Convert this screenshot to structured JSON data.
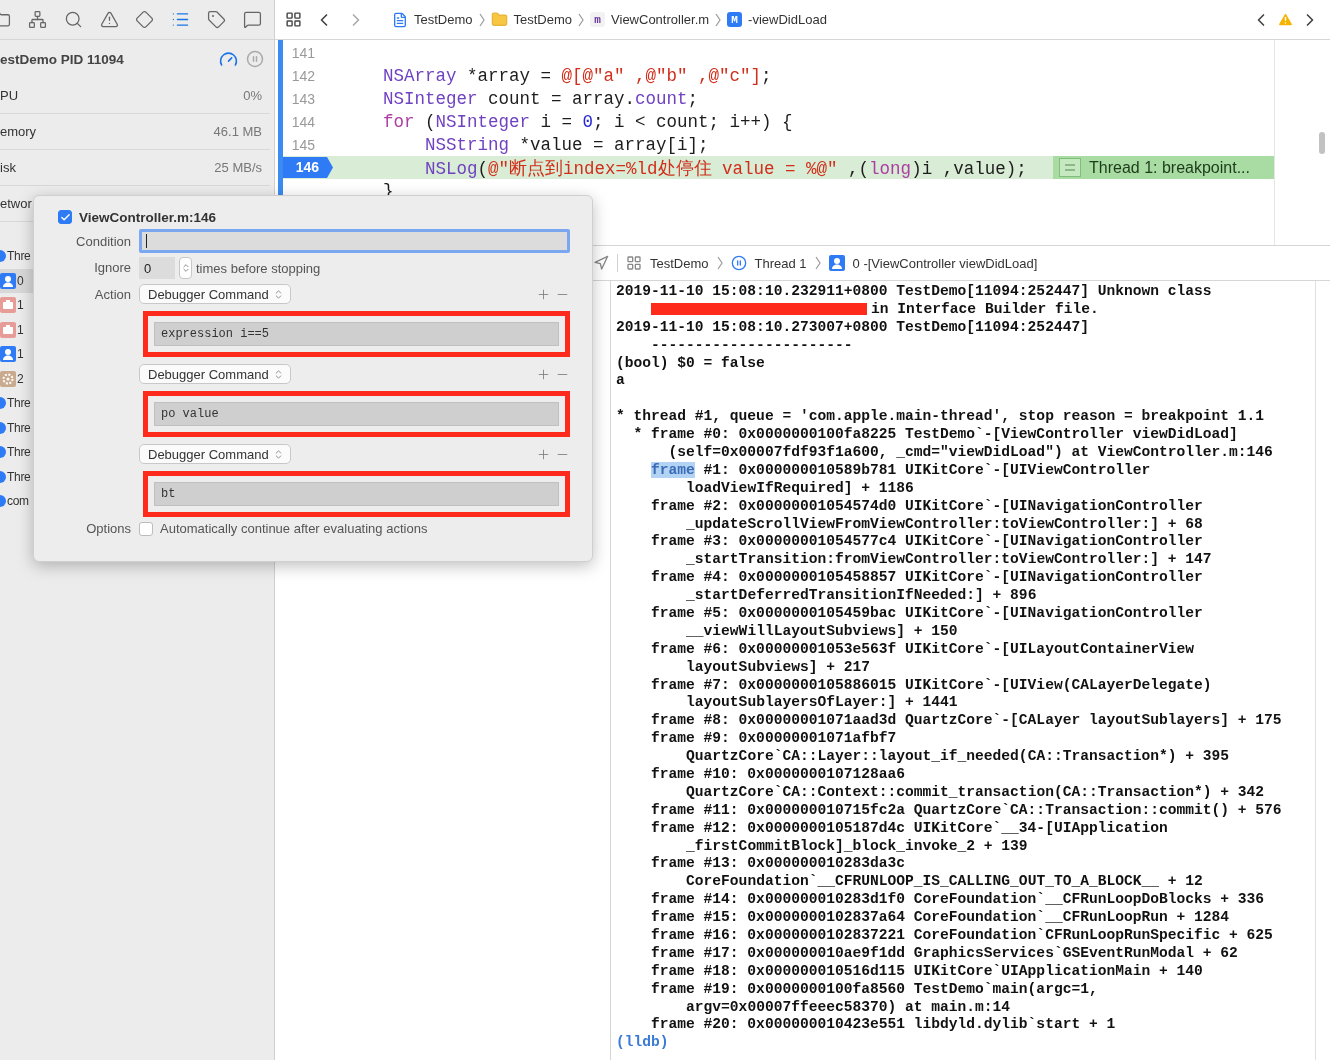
{
  "navigator": {
    "header": {
      "title": "estDemo PID 11094"
    },
    "gauges": [
      {
        "label": "PU",
        "value": "0%"
      },
      {
        "label": "emory",
        "value": "46.1 MB"
      },
      {
        "label": "isk",
        "value": "25 MB/s"
      },
      {
        "label": "etwor"
      }
    ],
    "threads": [
      {
        "kind": "thread",
        "label": "Thre",
        "selected": false
      },
      {
        "kind": "person",
        "label": "0",
        "selected": true
      },
      {
        "kind": "case",
        "label": "1",
        "selected": false
      },
      {
        "kind": "case",
        "label": "1",
        "selected": false
      },
      {
        "kind": "person",
        "label": "1",
        "selected": false
      },
      {
        "kind": "gear",
        "label": "2",
        "selected": false
      },
      {
        "kind": "thread",
        "label": "Thre",
        "selected": false
      },
      {
        "kind": "thread",
        "label": "Thre",
        "selected": false
      },
      {
        "kind": "thread",
        "label": "Thre",
        "selected": false
      },
      {
        "kind": "thread",
        "label": "Thre",
        "selected": false
      },
      {
        "kind": "thread",
        "label": "com",
        "selected": false
      }
    ]
  },
  "navigator_tabs": [
    {
      "kind": "folder",
      "selected": false
    },
    {
      "kind": "hierarchy",
      "selected": false
    },
    {
      "kind": "search",
      "selected": false
    },
    {
      "kind": "warning",
      "selected": false
    },
    {
      "kind": "diamond",
      "selected": false
    },
    {
      "kind": "list",
      "selected": true
    },
    {
      "kind": "tag",
      "selected": false
    },
    {
      "kind": "comment",
      "selected": false
    }
  ],
  "jump_bar": [
    {
      "kind": "project",
      "label": "TestDemo"
    },
    {
      "kind": "folder",
      "label": "TestDemo"
    },
    {
      "kind": "m-file",
      "badge": "m",
      "label": "ViewController.m"
    },
    {
      "kind": "method",
      "badge": "M",
      "label": "-viewDidLoad"
    }
  ],
  "editor": {
    "lines": [
      {
        "number": "141"
      },
      {
        "number": "142",
        "tokens": [
          {
            "t": "    NSArray",
            "kind": "type"
          },
          {
            "t": " *array = ",
            "kind": "plain"
          },
          {
            "t": "@[@\"a\" ,@\"b\" ,@\"c\"]",
            "kind": "string"
          },
          {
            "t": ";",
            "kind": "plain"
          }
        ]
      },
      {
        "number": "143",
        "tokens": [
          {
            "t": "    NSInteger",
            "kind": "type"
          },
          {
            "t": " count = array.",
            "kind": "plain"
          },
          {
            "t": "count",
            "kind": "type"
          },
          {
            "t": ";",
            "kind": "plain"
          }
        ]
      },
      {
        "number": "144",
        "tokens": [
          {
            "t": "    for",
            "kind": "keyword"
          },
          {
            "t": " (",
            "kind": "plain"
          },
          {
            "t": "NSInteger",
            "kind": "type"
          },
          {
            "t": " i = ",
            "kind": "plain"
          },
          {
            "t": "0",
            "kind": "number"
          },
          {
            "t": "; i < count; i++) {",
            "kind": "plain"
          }
        ]
      },
      {
        "number": "145",
        "tokens": [
          {
            "t": "        NSString",
            "kind": "type"
          },
          {
            "t": " *value = array[i];",
            "kind": "plain"
          }
        ]
      },
      {
        "number": "146",
        "current": true,
        "tokens": [
          {
            "t": "        NSLog",
            "kind": "type"
          },
          {
            "t": "(",
            "kind": "plain"
          },
          {
            "t": "@\"断点到index=%ld处停住 value = %@\"",
            "kind": "string"
          },
          {
            "t": " ,(",
            "kind": "plain"
          },
          {
            "t": "long",
            "kind": "keyword"
          },
          {
            "t": ")i ,value);",
            "kind": "plain"
          }
        ],
        "annotation": "Thread 1: breakpoint..."
      },
      {
        "tokens": [
          {
            "t": "    }",
            "kind": "plain"
          }
        ]
      }
    ]
  },
  "debug_bar": [
    {
      "kind": "app",
      "label": "TestDemo"
    },
    {
      "kind": "thread",
      "label": "Thread 1"
    },
    {
      "kind": "person",
      "label": "0 -[ViewController viewDidLoad]"
    }
  ],
  "console": [
    {
      "kind": "plain",
      "text": "2019-11-10 15:08:10.232911+0800 TestDemo[11094:252447] Unknown class"
    },
    {
      "kind": "redacted",
      "text": "in Interface Builder file."
    },
    {
      "kind": "plain",
      "text": "2019-11-10 15:08:10.273007+0800 TestDemo[11094:252447]"
    },
    {
      "kind": "frame",
      "text": "-----------------------"
    },
    {
      "kind": "plain",
      "text": "(bool) $0 = false"
    },
    {
      "kind": "plain",
      "text": "a"
    },
    {
      "kind": "blank"
    },
    {
      "kind": "plain",
      "text": "* thread #1, queue = 'com.apple.main-thread', stop reason = breakpoint 1.1"
    },
    {
      "kind": "top",
      "text": "* frame #0: 0x0000000100fa8225 TestDemo`-[ViewController viewDidLoad]"
    },
    {
      "kind": "sub",
      "text": "(self=0x00007fdf93f1a600, _cmd=\"viewDidLoad\") at ViewController.m:146"
    },
    {
      "kind": "frame",
      "selection": "frame",
      "text": "#1: 0x000000010589b781 UIKitCore`-[UIViewController"
    },
    {
      "kind": "cont",
      "text": "loadViewIfRequired] + 1186"
    },
    {
      "kind": "frame",
      "text": "frame #2: 0x00000001054574d0 UIKitCore`-[UINavigationController"
    },
    {
      "kind": "cont",
      "text": "_updateScrollViewFromViewController:toViewController:] + 68"
    },
    {
      "kind": "frame",
      "text": "frame #3: 0x00000001054577c4 UIKitCore`-[UINavigationController"
    },
    {
      "kind": "cont",
      "text": "_startTransition:fromViewController:toViewController:] + 147"
    },
    {
      "kind": "frame",
      "text": "frame #4: 0x0000000105458857 UIKitCore`-[UINavigationController"
    },
    {
      "kind": "cont",
      "text": "_startDeferredTransitionIfNeeded:] + 896"
    },
    {
      "kind": "frame",
      "text": "frame #5: 0x0000000105459bac UIKitCore`-[UINavigationController"
    },
    {
      "kind": "cont",
      "text": "__viewWillLayoutSubviews] + 150"
    },
    {
      "kind": "frame",
      "text": "frame #6: 0x00000001053e563f UIKitCore`-[UILayoutContainerView"
    },
    {
      "kind": "cont",
      "text": "layoutSubviews] + 217"
    },
    {
      "kind": "frame",
      "text": "frame #7: 0x0000000105886015 UIKitCore`-[UIView(CALayerDelegate)"
    },
    {
      "kind": "cont",
      "text": "layoutSublayersOfLayer:] + 1441"
    },
    {
      "kind": "frame",
      "text": "frame #8: 0x00000001071aad3d QuartzCore`-[CALayer layoutSublayers] + 175"
    },
    {
      "kind": "frame",
      "text": "frame #9: 0x00000001071afbf7"
    },
    {
      "kind": "cont",
      "text": "QuartzCore`CA::Layer::layout_if_needed(CA::Transaction*) + 395"
    },
    {
      "kind": "frame",
      "text": "frame #10: 0x0000000107128aa6"
    },
    {
      "kind": "cont",
      "text": "QuartzCore`CA::Context::commit_transaction(CA::Transaction*) + 342"
    },
    {
      "kind": "frame",
      "text": "frame #11: 0x000000010715fc2a QuartzCore`CA::Transaction::commit() + 576"
    },
    {
      "kind": "frame",
      "text": "frame #12: 0x0000000105187d4c UIKitCore`__34-[UIApplication"
    },
    {
      "kind": "cont",
      "text": "_firstCommitBlock]_block_invoke_2 + 139"
    },
    {
      "kind": "frame",
      "text": "frame #13: 0x000000010283da3c"
    },
    {
      "kind": "cont",
      "text": "CoreFoundation`__CFRUNLOOP_IS_CALLING_OUT_TO_A_BLOCK__ + 12"
    },
    {
      "kind": "frame",
      "text": "frame #14: 0x000000010283d1f0 CoreFoundation`__CFRunLoopDoBlocks + 336"
    },
    {
      "kind": "frame",
      "text": "frame #15: 0x0000000102837a64 CoreFoundation`__CFRunLoopRun + 1284"
    },
    {
      "kind": "frame",
      "text": "frame #16: 0x0000000102837221 CoreFoundation`CFRunLoopRunSpecific + 625"
    },
    {
      "kind": "frame",
      "text": "frame #17: 0x000000010ae9f1dd GraphicsServices`GSEventRunModal + 62"
    },
    {
      "kind": "frame",
      "text": "frame #18: 0x000000010516d115 UIKitCore`UIApplicationMain + 140"
    },
    {
      "kind": "frame",
      "text": "frame #19: 0x0000000100fa8560 TestDemo`main(argc=1,"
    },
    {
      "kind": "cont",
      "text": "argv=0x00007ffeeec58370) at main.m:14"
    },
    {
      "kind": "frame",
      "text": "frame #20: 0x000000010423e551 libdyld.dylib`start + 1"
    },
    {
      "kind": "prompt",
      "text": "(lldb)"
    }
  ],
  "breakpoint_popover": {
    "enabled": true,
    "title": "ViewController.m:146",
    "condition": {
      "label": "Condition",
      "focused": true
    },
    "ignore": {
      "label": "Ignore",
      "value": "0",
      "suffix": "times before stopping"
    },
    "action_label": "Action",
    "actions": [
      {
        "type": "Debugger Command",
        "command": "expression i==5",
        "highlighted": true
      },
      {
        "type": "Debugger Command",
        "command": "po value",
        "highlighted": true
      },
      {
        "type": "Debugger Command",
        "command": "bt",
        "highlighted": true
      }
    ],
    "options": {
      "label": "Options",
      "checkbox_label": "Automatically continue after evaluating actions",
      "checked": false
    }
  }
}
